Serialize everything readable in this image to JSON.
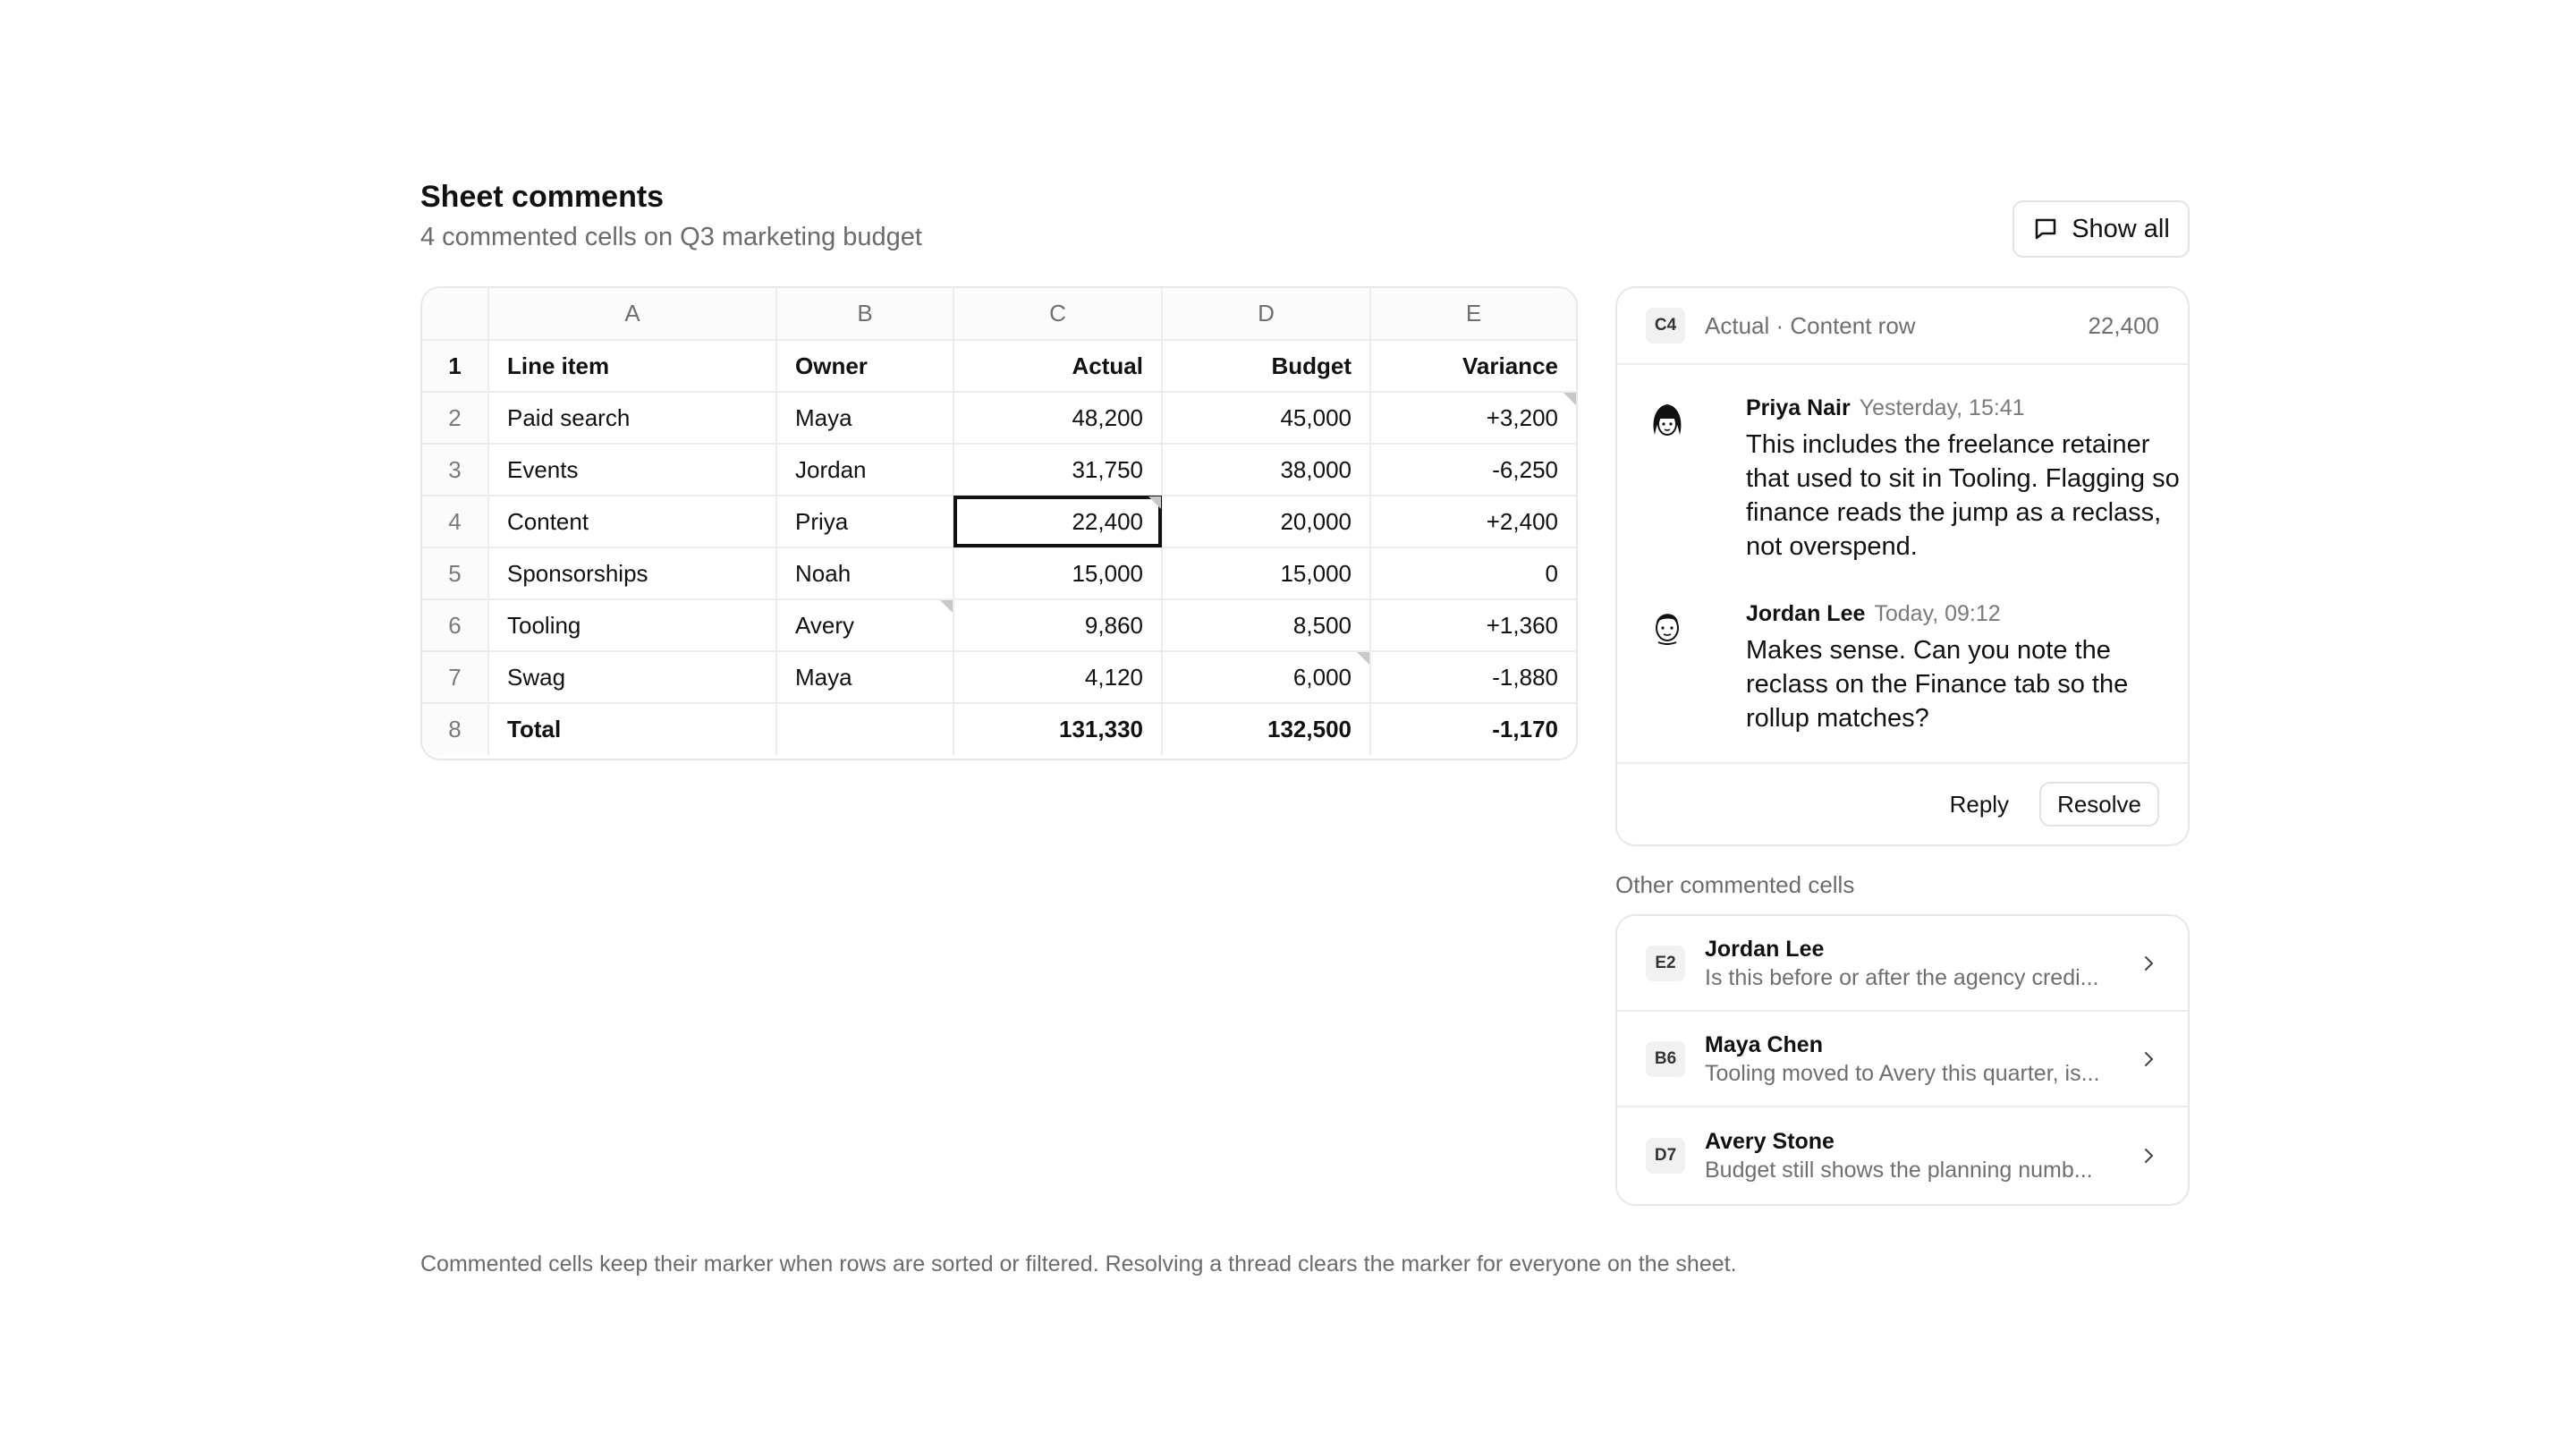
{
  "header": {
    "title": "Sheet comments",
    "subtitle": "4 commented cells on Q3 marketing budget",
    "show_all_label": "Show all",
    "show_all_icon": "comment-icon"
  },
  "sheet": {
    "columns": [
      "A",
      "B",
      "C",
      "D",
      "E"
    ],
    "rows": [
      {
        "n": "1",
        "cells": [
          "Line item",
          "Owner",
          "Actual",
          "Budget",
          "Variance"
        ]
      },
      {
        "n": "2",
        "cells": [
          "Paid search",
          "Maya",
          "48,200",
          "45,000",
          "+3,200"
        ]
      },
      {
        "n": "3",
        "cells": [
          "Events",
          "Jordan",
          "31,750",
          "38,000",
          "-6,250"
        ]
      },
      {
        "n": "4",
        "cells": [
          "Content",
          "Priya",
          "22,400",
          "20,000",
          "+2,400"
        ]
      },
      {
        "n": "5",
        "cells": [
          "Sponsorships",
          "Noah",
          "15,000",
          "15,000",
          "0"
        ]
      },
      {
        "n": "6",
        "cells": [
          "Tooling",
          "Avery",
          "9,860",
          "8,500",
          "+1,360"
        ]
      },
      {
        "n": "7",
        "cells": [
          "Swag",
          "Maya",
          "4,120",
          "6,000",
          "-1,880"
        ]
      },
      {
        "n": "8",
        "cells": [
          "Total",
          "",
          "131,330",
          "132,500",
          "-1,170"
        ]
      }
    ]
  },
  "thread": {
    "cell": "C4",
    "context": "Actual · Content row",
    "value": "22,400",
    "comments": [
      {
        "author": "Priya Nair",
        "time": "Yesterday, 15:41",
        "body": "This includes the freelance retainer that used to sit in Tooling. Flagging so finance reads the jump as a reclass, not overspend.",
        "avatar_icon": "avatar-icon"
      },
      {
        "author": "Jordan Lee",
        "time": "Today, 09:12",
        "body": "Makes sense. Can you note the reclass on the Finance tab so the rollup matches?",
        "avatar_icon": "avatar-icon"
      }
    ],
    "reply_label": "Reply",
    "resolve_label": "Resolve"
  },
  "others": {
    "label": "Other commented cells",
    "items": [
      {
        "cell": "E2",
        "author": "Jordan Lee",
        "snippet": "Is this before or after the agency credi..."
      },
      {
        "cell": "B6",
        "author": "Maya Chen",
        "snippet": "Tooling moved to Avery this quarter, is..."
      },
      {
        "cell": "D7",
        "author": "Avery Stone",
        "snippet": "Budget still shows the planning numb..."
      }
    ]
  },
  "footnote": "Commented cells keep their marker when rows are sorted or filtered. Resolving a thread clears the marker for everyone on the sheet."
}
